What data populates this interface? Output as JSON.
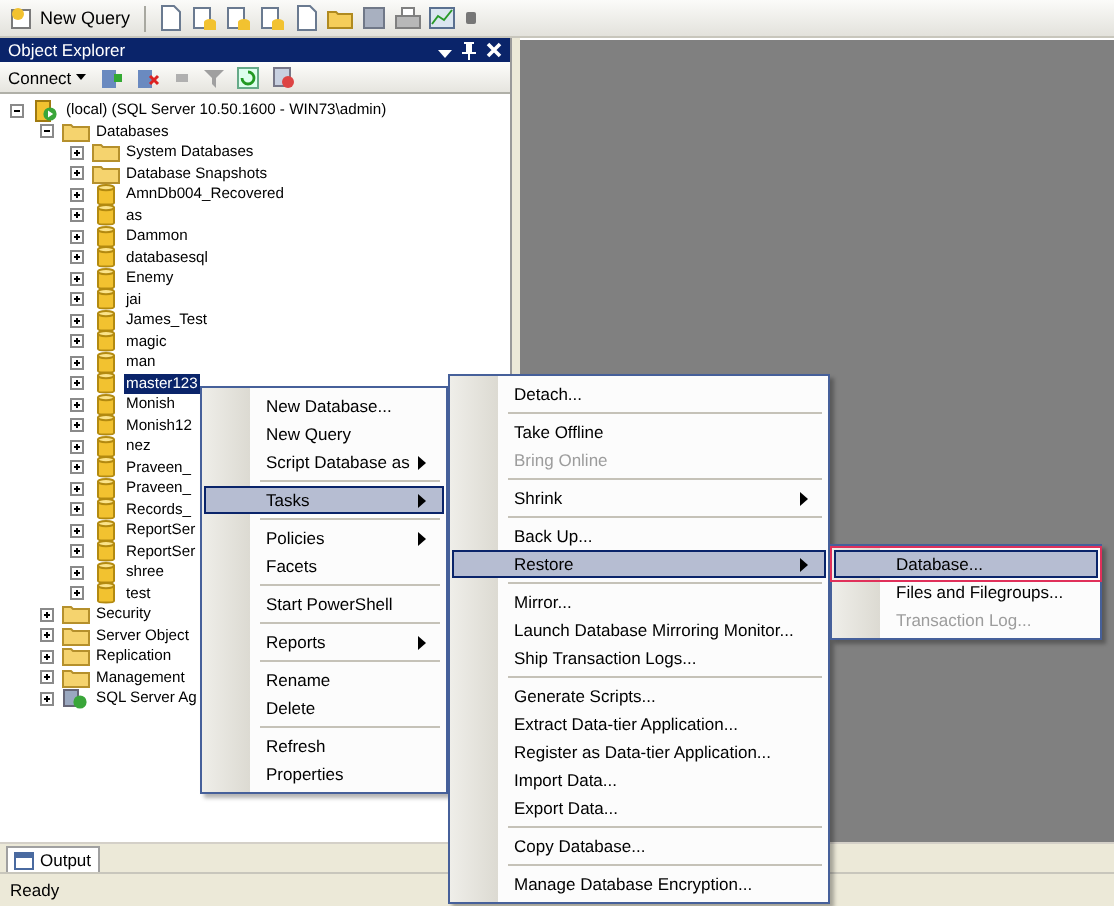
{
  "toolbar": {
    "new_query": "New Query"
  },
  "object_explorer": {
    "title": "Object Explorer",
    "connect": "Connect",
    "tree": [
      {
        "kind": "server",
        "label": "(local) (SQL Server 10.50.1600 - WIN73\\admin)",
        "expanded": true,
        "selected": false,
        "children": [
          {
            "kind": "folder",
            "label": "Databases",
            "expanded": true,
            "selected": false,
            "children": [
              {
                "kind": "folder",
                "label": "System Databases",
                "expanded": false,
                "selected": false
              },
              {
                "kind": "folder",
                "label": "Database Snapshots",
                "expanded": false,
                "selected": false
              },
              {
                "kind": "database",
                "label": "AmnDb004_Recovered",
                "expanded": false,
                "selected": false
              },
              {
                "kind": "database",
                "label": "as",
                "expanded": false,
                "selected": false
              },
              {
                "kind": "database",
                "label": "Dammon",
                "expanded": false,
                "selected": false
              },
              {
                "kind": "database",
                "label": "databasesql",
                "expanded": false,
                "selected": false
              },
              {
                "kind": "database",
                "label": "Enemy",
                "expanded": false,
                "selected": false
              },
              {
                "kind": "database",
                "label": "jai",
                "expanded": false,
                "selected": false
              },
              {
                "kind": "database",
                "label": "James_Test",
                "expanded": false,
                "selected": false
              },
              {
                "kind": "database",
                "label": "magic",
                "expanded": false,
                "selected": false
              },
              {
                "kind": "database",
                "label": "man",
                "expanded": false,
                "selected": false
              },
              {
                "kind": "database",
                "label": "master123",
                "expanded": false,
                "selected": true
              },
              {
                "kind": "database",
                "label": "Monish",
                "expanded": false,
                "selected": false
              },
              {
                "kind": "database",
                "label": "Monish12",
                "expanded": false,
                "selected": false
              },
              {
                "kind": "database",
                "label": "nez",
                "expanded": false,
                "selected": false
              },
              {
                "kind": "database",
                "label": "Praveen_",
                "expanded": false,
                "selected": false
              },
              {
                "kind": "database",
                "label": "Praveen_",
                "expanded": false,
                "selected": false
              },
              {
                "kind": "database",
                "label": "Records_",
                "expanded": false,
                "selected": false
              },
              {
                "kind": "database",
                "label": "ReportSer",
                "expanded": false,
                "selected": false
              },
              {
                "kind": "database",
                "label": "ReportSer",
                "expanded": false,
                "selected": false
              },
              {
                "kind": "database",
                "label": "shree",
                "expanded": false,
                "selected": false
              },
              {
                "kind": "database",
                "label": "test",
                "expanded": false,
                "selected": false
              }
            ]
          },
          {
            "kind": "folder",
            "label": "Security",
            "expanded": false,
            "selected": false
          },
          {
            "kind": "folder",
            "label": "Server Object",
            "expanded": false,
            "selected": false
          },
          {
            "kind": "folder",
            "label": "Replication",
            "expanded": false,
            "selected": false
          },
          {
            "kind": "folder",
            "label": "Management",
            "expanded": false,
            "selected": false
          },
          {
            "kind": "agent",
            "label": "SQL Server Ag",
            "expanded": false,
            "selected": false
          }
        ]
      }
    ]
  },
  "context_menus": [
    {
      "items": [
        {
          "kind": "item",
          "label": "New Database...",
          "submenu": false,
          "selected": false,
          "disabled": false
        },
        {
          "kind": "item",
          "label": "New Query",
          "submenu": false,
          "selected": false,
          "disabled": false
        },
        {
          "kind": "item",
          "label": "Script Database as",
          "submenu": true,
          "selected": false,
          "disabled": false
        },
        {
          "kind": "separator"
        },
        {
          "kind": "item",
          "label": "Tasks",
          "submenu": true,
          "selected": true,
          "disabled": false
        },
        {
          "kind": "separator"
        },
        {
          "kind": "item",
          "label": "Policies",
          "submenu": true,
          "selected": false,
          "disabled": false
        },
        {
          "kind": "item",
          "label": "Facets",
          "submenu": false,
          "selected": false,
          "disabled": false
        },
        {
          "kind": "separator"
        },
        {
          "kind": "item",
          "label": "Start PowerShell",
          "submenu": false,
          "selected": false,
          "disabled": false
        },
        {
          "kind": "separator"
        },
        {
          "kind": "item",
          "label": "Reports",
          "submenu": true,
          "selected": false,
          "disabled": false
        },
        {
          "kind": "separator"
        },
        {
          "kind": "item",
          "label": "Rename",
          "submenu": false,
          "selected": false,
          "disabled": false
        },
        {
          "kind": "item",
          "label": "Delete",
          "submenu": false,
          "selected": false,
          "disabled": false
        },
        {
          "kind": "separator"
        },
        {
          "kind": "item",
          "label": "Refresh",
          "submenu": false,
          "selected": false,
          "disabled": false
        },
        {
          "kind": "item",
          "label": "Properties",
          "submenu": false,
          "selected": false,
          "disabled": false
        }
      ]
    },
    {
      "items": [
        {
          "kind": "item",
          "label": "Detach...",
          "submenu": false,
          "selected": false,
          "disabled": false
        },
        {
          "kind": "separator"
        },
        {
          "kind": "item",
          "label": "Take Offline",
          "submenu": false,
          "selected": false,
          "disabled": false
        },
        {
          "kind": "item",
          "label": "Bring Online",
          "submenu": false,
          "selected": false,
          "disabled": true
        },
        {
          "kind": "separator"
        },
        {
          "kind": "item",
          "label": "Shrink",
          "submenu": true,
          "selected": false,
          "disabled": false
        },
        {
          "kind": "separator"
        },
        {
          "kind": "item",
          "label": "Back Up...",
          "submenu": false,
          "selected": false,
          "disabled": false
        },
        {
          "kind": "item",
          "label": "Restore",
          "submenu": true,
          "selected": true,
          "disabled": false
        },
        {
          "kind": "separator"
        },
        {
          "kind": "item",
          "label": "Mirror...",
          "submenu": false,
          "selected": false,
          "disabled": false
        },
        {
          "kind": "item",
          "label": "Launch Database Mirroring Monitor...",
          "submenu": false,
          "selected": false,
          "disabled": false
        },
        {
          "kind": "item",
          "label": "Ship Transaction Logs...",
          "submenu": false,
          "selected": false,
          "disabled": false
        },
        {
          "kind": "separator"
        },
        {
          "kind": "item",
          "label": "Generate Scripts...",
          "submenu": false,
          "selected": false,
          "disabled": false
        },
        {
          "kind": "item",
          "label": "Extract Data-tier Application...",
          "submenu": false,
          "selected": false,
          "disabled": false
        },
        {
          "kind": "item",
          "label": "Register as Data-tier Application...",
          "submenu": false,
          "selected": false,
          "disabled": false
        },
        {
          "kind": "item",
          "label": "Import Data...",
          "submenu": false,
          "selected": false,
          "disabled": false
        },
        {
          "kind": "item",
          "label": "Export Data...",
          "submenu": false,
          "selected": false,
          "disabled": false
        },
        {
          "kind": "separator"
        },
        {
          "kind": "item",
          "label": "Copy Database...",
          "submenu": false,
          "selected": false,
          "disabled": false
        },
        {
          "kind": "separator"
        },
        {
          "kind": "item",
          "label": "Manage Database Encryption...",
          "submenu": false,
          "selected": false,
          "disabled": false
        }
      ]
    },
    {
      "items": [
        {
          "kind": "item",
          "label": "Database...",
          "submenu": false,
          "selected": true,
          "disabled": false,
          "outlined": true
        },
        {
          "kind": "item",
          "label": "Files and Filegroups...",
          "submenu": false,
          "selected": false,
          "disabled": false,
          "outlined": false
        },
        {
          "kind": "item",
          "label": "Transaction Log...",
          "submenu": false,
          "selected": false,
          "disabled": true,
          "outlined": false
        }
      ]
    }
  ],
  "output_tab": "Output",
  "status_bar": "Ready"
}
